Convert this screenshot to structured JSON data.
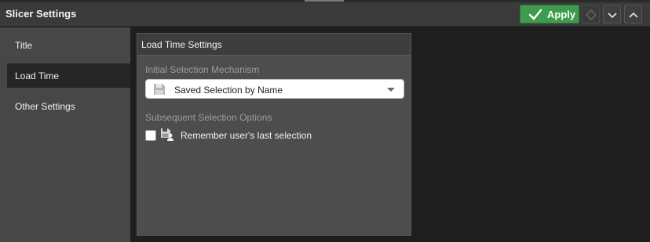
{
  "header": {
    "title": "Slicer Settings",
    "apply_label": "Apply"
  },
  "sidebar": {
    "items": [
      {
        "label": "Title"
      },
      {
        "label": "Load Time"
      },
      {
        "label": "Other Settings"
      }
    ],
    "active_item": "Load Time"
  },
  "panel": {
    "title": "Load Time Settings",
    "initial_selection": {
      "label": "Initial Selection Mechanism",
      "selected_value": "Saved Selection by Name",
      "icon": "save-icon"
    },
    "subsequent_selection": {
      "label": "Subsequent Selection Options",
      "remember_label": "Remember user's last selection",
      "remember_checked": false,
      "icon": "save-user-icon"
    }
  },
  "colors": {
    "apply_green": "#3e9a4d",
    "header_bg": "#3a3a3a",
    "sidebar_bg": "#474747",
    "panel_bg": "#4d4d4d",
    "active_item_bg": "#262626"
  }
}
